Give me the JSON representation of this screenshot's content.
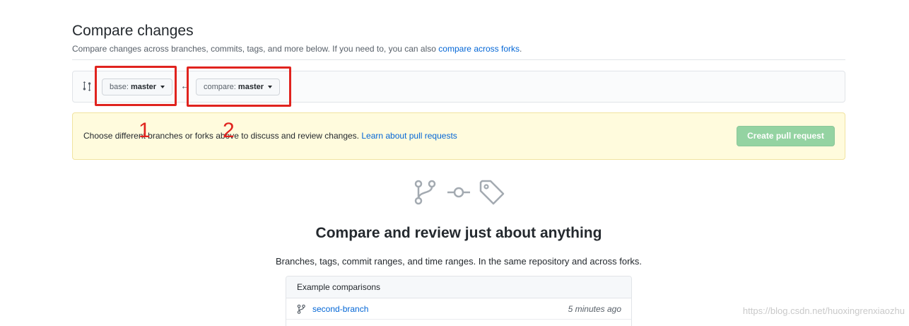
{
  "page": {
    "title": "Compare changes",
    "subtitle": "Compare changes across branches, commits, tags, and more below. If you need to, you can also",
    "subtitle_link": "compare across forks",
    "subtitle_end": "."
  },
  "range": {
    "base_prefix": "base:",
    "base_value": "master",
    "compare_prefix": "compare:",
    "compare_value": "master"
  },
  "annotations": {
    "marker_1": "1",
    "marker_2": "2",
    "color": "#e0231e"
  },
  "flash": {
    "text": "Choose different branches or forks above to discuss and review changes.",
    "link": "Learn about pull requests",
    "button": "Create pull request"
  },
  "blankslate": {
    "icons": [
      "git-branch-icon",
      "git-commit-icon",
      "tag-icon"
    ],
    "title": "Compare and review just about anything",
    "description": "Branches, tags, commit ranges, and time ranges. In the same repository and across forks."
  },
  "examples": {
    "header": "Example comparisons",
    "rows": [
      {
        "icon": "git-branch-icon",
        "name": "second-branch",
        "time": "5 minutes ago"
      }
    ]
  },
  "watermark": "https://blog.csdn.net/huoxingrenxiaozhu",
  "colors": {
    "link": "#0366d6",
    "flash_bg": "#fffbdd",
    "button_disabled": "#94d3a2"
  }
}
